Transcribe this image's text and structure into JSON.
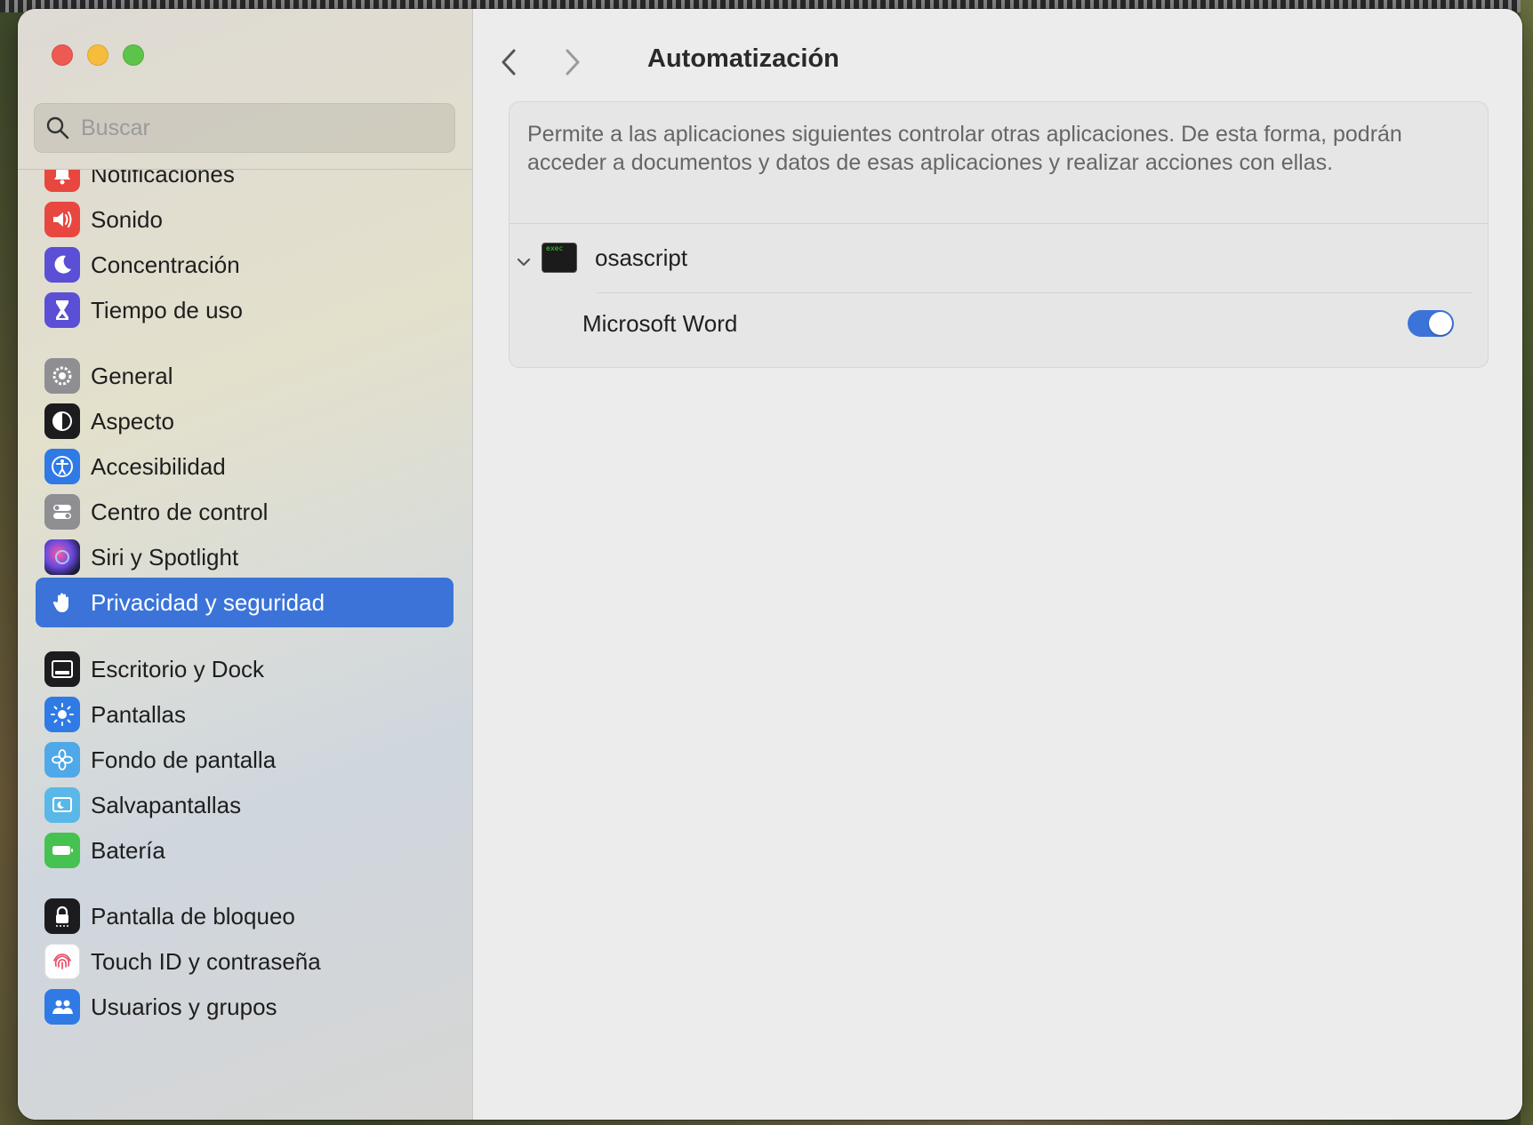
{
  "search": {
    "placeholder": "Buscar"
  },
  "sidebar": {
    "items": [
      {
        "label": "Notificaciones",
        "icon": "bell-icon",
        "color": "#e8473f"
      },
      {
        "label": "Sonido",
        "icon": "speaker-icon",
        "color": "#e8473f"
      },
      {
        "label": "Concentración",
        "icon": "moon-icon",
        "color": "#5b4fd6"
      },
      {
        "label": "Tiempo de uso",
        "icon": "hourglass-icon",
        "color": "#5b4fd6"
      },
      {
        "label": "General",
        "icon": "gear-icon",
        "color": "#8e8e93"
      },
      {
        "label": "Aspecto",
        "icon": "appearance-icon",
        "color": "#1c1c1e"
      },
      {
        "label": "Accesibilidad",
        "icon": "accessibility-icon",
        "color": "#2f7ae5"
      },
      {
        "label": "Centro de control",
        "icon": "control-center-icon",
        "color": "#8e8e93"
      },
      {
        "label": "Siri y Spotlight",
        "icon": "siri-icon",
        "color": "#3a2a6a"
      },
      {
        "label": "Privacidad y seguridad",
        "icon": "hand-icon",
        "color": "#3b73d9",
        "active": true
      },
      {
        "label": "Escritorio y Dock",
        "icon": "dock-icon",
        "color": "#1c1c1e"
      },
      {
        "label": "Pantallas",
        "icon": "sun-icon",
        "color": "#2f7ae5"
      },
      {
        "label": "Fondo de pantalla",
        "icon": "flower-icon",
        "color": "#4fa8e8"
      },
      {
        "label": "Salvapantallas",
        "icon": "screensaver-icon",
        "color": "#5ab8e8"
      },
      {
        "label": "Batería",
        "icon": "battery-icon",
        "color": "#45c24f"
      },
      {
        "label": "Pantalla de bloqueo",
        "icon": "lock-icon",
        "color": "#1c1c1e"
      },
      {
        "label": "Touch ID y contraseña",
        "icon": "fingerprint-icon",
        "color": "#ffffff"
      },
      {
        "label": "Usuarios y grupos",
        "icon": "users-icon",
        "color": "#2f7ae5"
      }
    ]
  },
  "main": {
    "title": "Automatización",
    "description": "Permite a las aplicaciones siguientes controlar otras aplicaciones. De esta forma, podrán acceder a documentos y datos de esas aplicaciones y realizar acciones con ellas.",
    "app": {
      "name": "osascript",
      "icon_text": "exec"
    },
    "sub_app": {
      "name": "Microsoft Word",
      "enabled": true
    }
  },
  "colors": {
    "accent": "#3b73d9"
  }
}
